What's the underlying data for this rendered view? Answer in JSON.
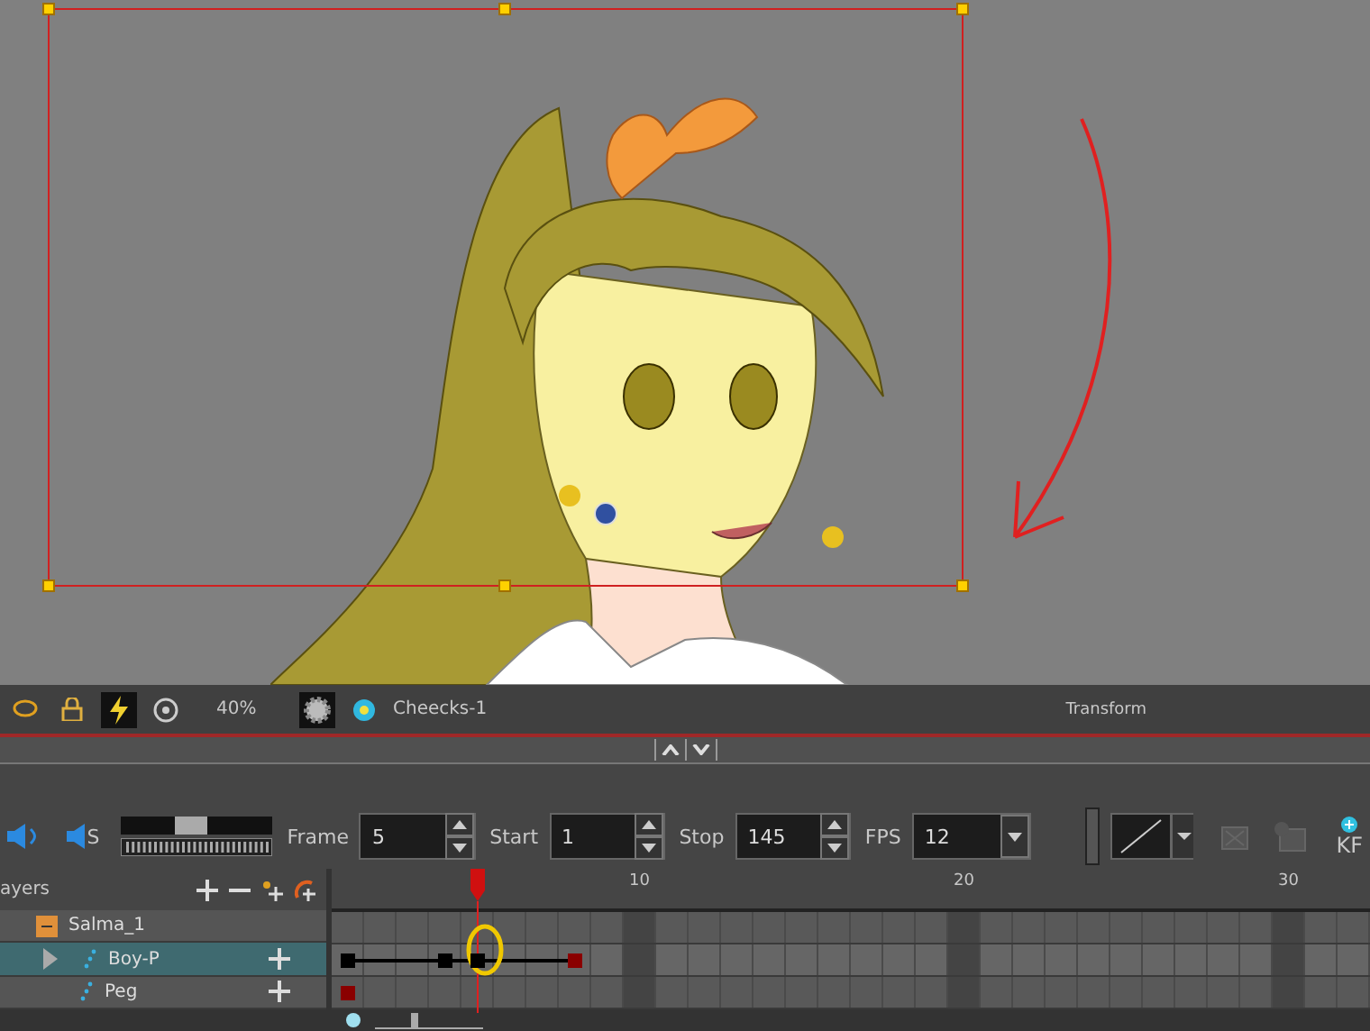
{
  "viewport": {
    "view_title": "Transform"
  },
  "toolbar": {
    "zoom": "40%",
    "drawing": "Cheecks-1"
  },
  "playback": {
    "sound_label": "S",
    "sound_slider": {
      "level": 0.45
    },
    "fields": [
      {
        "label": "Frame",
        "value": "5",
        "kind": "spin"
      },
      {
        "label": "Start",
        "value": "1",
        "kind": "spin"
      },
      {
        "label": "Stop",
        "value": "145",
        "kind": "spin"
      },
      {
        "label": "FPS",
        "value": "12",
        "kind": "dropdown"
      }
    ],
    "keyframe_label": "KF"
  },
  "timeline": {
    "layers_header": "ayers",
    "ruler_labels": [
      "10",
      "20",
      "30"
    ],
    "layers": [
      {
        "name": "Salma_1",
        "kind": "group",
        "selected": false,
        "collapsed": false
      },
      {
        "name": "Boy-P",
        "kind": "peg",
        "selected": true,
        "collapsed": true,
        "keyframes": [
          {
            "level": 0.016,
            "color": "#000000"
          },
          {
            "level": 0.109,
            "color": "#000000"
          },
          {
            "level": 0.141,
            "color": "#000000"
          },
          {
            "level": 0.234,
            "color": "#8a0000"
          }
        ]
      },
      {
        "name": "Peg",
        "kind": "peg",
        "selected": false,
        "collapsed": false,
        "keyframes": [
          {
            "level": 0.016,
            "color": "#8a0000"
          }
        ]
      }
    ],
    "zoom_slider": {
      "level": 0.35
    }
  }
}
